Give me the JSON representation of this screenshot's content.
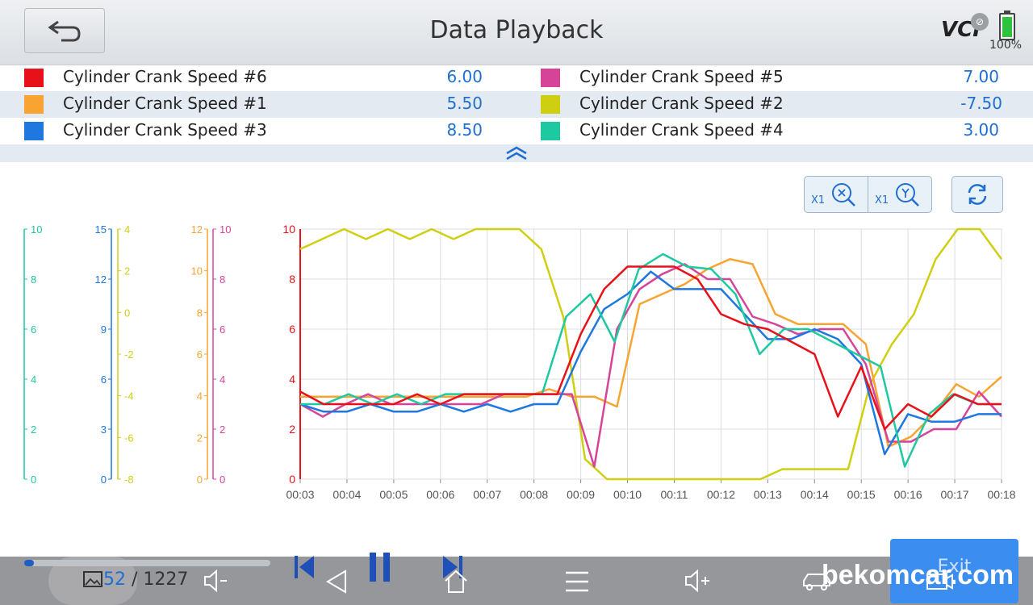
{
  "header": {
    "title": "Data Playback",
    "vci_label": "VCI",
    "battery_text": "100%"
  },
  "legend": [
    {
      "name": "Cylinder Crank Speed #6",
      "value": "6.00",
      "color": "#e8111a"
    },
    {
      "name": "Cylinder Crank Speed #5",
      "value": "7.00",
      "color": "#d6449a"
    },
    {
      "name": "Cylinder Crank Speed #1",
      "value": "5.50",
      "color": "#f7a433"
    },
    {
      "name": "Cylinder Crank Speed #2",
      "value": "-7.50",
      "color": "#cfcf12"
    },
    {
      "name": "Cylinder Crank Speed #3",
      "value": "8.50",
      "color": "#1f77e0"
    },
    {
      "name": "Cylinder Crank Speed #4",
      "value": "3.00",
      "color": "#1ec8a0"
    }
  ],
  "zoom": {
    "x_label": "X1",
    "y_label": "X1"
  },
  "chart_data": {
    "type": "line",
    "x": [
      "00:03",
      "00:04",
      "00:05",
      "00:06",
      "00:07",
      "00:08",
      "00:09",
      "00:10",
      "00:11",
      "00:12",
      "00:13",
      "00:14",
      "00:15",
      "00:16",
      "00:17",
      "00:18"
    ],
    "ylim": [
      0,
      10
    ],
    "grid": true,
    "ticks": {
      "main": [
        "0",
        "2",
        "4",
        "6",
        "8",
        "10"
      ],
      "teal": [
        "0",
        "2",
        "4",
        "6",
        "8",
        "10"
      ],
      "blue": [
        "0",
        "3",
        "6",
        "9",
        "12",
        "15"
      ],
      "yellow": [
        "-8",
        "-6",
        "-4",
        "-2",
        "0",
        "2",
        "4"
      ],
      "orange": [
        "0",
        "2",
        "4",
        "6",
        "8",
        "10",
        "12"
      ],
      "pink": [
        "0",
        "2",
        "4",
        "6",
        "8",
        "10"
      ]
    },
    "tick_colors": {
      "teal": "#1ec8a0",
      "blue": "#1f77e0",
      "yellow": "#cfcf12",
      "orange": "#f7a433",
      "pink": "#d6449a",
      "main": "#e8111a"
    },
    "series": [
      {
        "color": "#cfcf12",
        "values": [
          9.2,
          9.6,
          10,
          9.6,
          10,
          9.6,
          10,
          9.6,
          10,
          10,
          10,
          9.2,
          6.5,
          0.8,
          0,
          0,
          0,
          0,
          0,
          0,
          0,
          0,
          0.4,
          0.4,
          0.4,
          0.4,
          3.8,
          5.4,
          6.6,
          8.8,
          10,
          10,
          8.8
        ]
      },
      {
        "color": "#f7a433",
        "values": [
          3.3,
          3.3,
          3.3,
          3.3,
          3.3,
          3.3,
          3.3,
          3.3,
          3.3,
          3.3,
          3.3,
          3.6,
          3.3,
          3.3,
          2.9,
          7.0,
          7.4,
          7.8,
          8.4,
          8.8,
          8.6,
          6.6,
          6.2,
          6.2,
          6.2,
          5.4,
          1.3,
          1.7,
          2.6,
          3.8,
          3.3,
          4.1
        ]
      },
      {
        "color": "#d6449a",
        "values": [
          3.0,
          2.5,
          3.0,
          3.4,
          3.0,
          3.0,
          3.0,
          3.0,
          3.0,
          3.4,
          3.4,
          3.4,
          3.4,
          0.5,
          6.0,
          7.6,
          8.2,
          8.6,
          8.0,
          8.0,
          6.5,
          6.2,
          5.8,
          6.0,
          6.0,
          4.6,
          1.5,
          1.5,
          2.0,
          2.0,
          3.5,
          2.5
        ]
      },
      {
        "color": "#1f77e0",
        "values": [
          3.0,
          2.7,
          2.7,
          3.0,
          2.7,
          2.7,
          3.0,
          2.7,
          3.0,
          2.7,
          3.0,
          3.0,
          5.1,
          6.8,
          7.4,
          8.3,
          7.6,
          7.6,
          7.6,
          6.6,
          5.6,
          5.6,
          6.0,
          5.6,
          4.6,
          1.0,
          2.6,
          2.3,
          2.3,
          2.6,
          2.6
        ]
      },
      {
        "color": "#1ec8a0",
        "values": [
          3.0,
          3.0,
          3.4,
          3.0,
          3.4,
          3.0,
          3.4,
          3.4,
          3.4,
          3.4,
          3.4,
          6.5,
          7.4,
          5.5,
          8.4,
          9.0,
          8.5,
          8.4,
          7.4,
          5.0,
          6.0,
          6.0,
          5.5,
          5.0,
          4.5,
          0.5,
          2.6,
          3.4,
          3.0,
          3.0
        ]
      },
      {
        "color": "#e8111a",
        "values": [
          3.5,
          3.0,
          3.0,
          3.0,
          3.0,
          3.4,
          3.0,
          3.4,
          3.4,
          3.4,
          3.4,
          3.4,
          5.8,
          7.6,
          8.5,
          8.5,
          8.5,
          8.0,
          6.6,
          6.2,
          6.0,
          5.5,
          5.0,
          2.5,
          4.5,
          2.0,
          3.0,
          2.5,
          3.4,
          3.0,
          3.0
        ]
      }
    ]
  },
  "player": {
    "current_frame": "52",
    "separator": "/",
    "total_frames": "1227",
    "progress": 0.04
  },
  "exit_label": "Exit",
  "watermark": "bekomcar.com"
}
